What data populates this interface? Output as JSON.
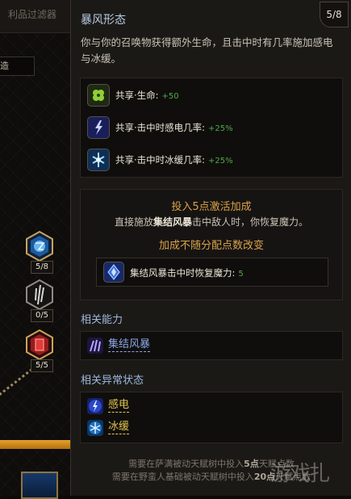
{
  "background": {
    "filter_header": "利品过滤器",
    "filter_box_text": "造",
    "nodes": [
      {
        "count": "5/8",
        "icon": "storm-node-icon"
      },
      {
        "count": "0/5",
        "icon": "claw-node-icon"
      },
      {
        "count": "5/5",
        "icon": "red-rune-node-icon"
      }
    ]
  },
  "tooltip": {
    "title": "暴风形态",
    "rank": "5/8",
    "description": "你与你的召唤物获得额外生命，且击中时有几率施加感电与冰缓。",
    "stats": [
      {
        "label": "共享·生命:",
        "value": "+50",
        "icon": "clover-icon",
        "color": "#7fb63a"
      },
      {
        "label": "共享·击中时感电几率:",
        "value": "+25%",
        "icon": "lightning-icon",
        "color": "#3c4fb8"
      },
      {
        "label": "共享·击中时冰缓几率:",
        "value": "+25%",
        "icon": "frost-icon",
        "color": "#2a6fb0"
      }
    ],
    "bonus": {
      "title": "投入5点激活加成",
      "desc_prefix": "直接施放",
      "desc_skill": "集结风暴",
      "desc_suffix": "击中敌人时，你恢复魔力。",
      "note": "加成不随分配点数改变",
      "stat_label": "集结风暴击中时恢复魔力:",
      "stat_value": "5",
      "stat_icon": "mana-crystal-icon"
    },
    "related_abilities": {
      "heading": "相关能力",
      "items": [
        {
          "label": "集结风暴",
          "icon": "storm-claw-icon",
          "color": "#8aa7e6"
        }
      ]
    },
    "related_status": {
      "heading": "相关异常状态",
      "items": [
        {
          "label": "感电",
          "icon": "shock-icon",
          "color": "#e2c34e"
        },
        {
          "label": "冰缓",
          "icon": "chill-icon",
          "color": "#e2c34e"
        }
      ]
    },
    "footer": {
      "line1_prefix": "需要在萨满被动天赋树中投入",
      "line1_bold": "5点",
      "line1_suffix": "天赋点数",
      "line2_prefix": "需要在野蛮人基础被动天赋树中投入",
      "line2_bold": "20点",
      "line2_suffix": "天赋点数"
    }
  },
  "watermark": "游戏扎"
}
